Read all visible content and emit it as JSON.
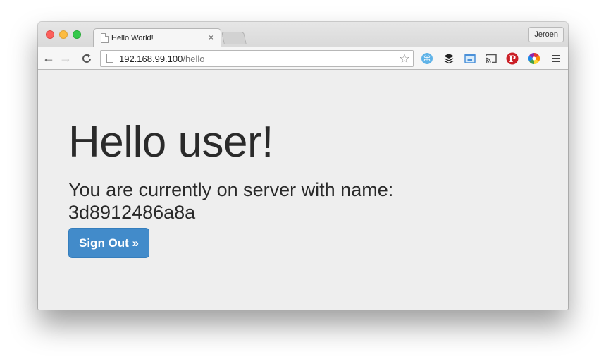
{
  "browser": {
    "tab_title": "Hello World!",
    "tab_close": "×",
    "profile_name": "Jeroen",
    "url_host": "192.168.99.100",
    "url_path": "/hello",
    "nav": {
      "back": "←",
      "forward": "→",
      "reload": "C"
    },
    "bookmark_star": "☆",
    "menu_glyph": "≡"
  },
  "page": {
    "heading": "Hello user!",
    "lead": "You are currently on server with name: 3d8912486a8a",
    "signout_label": "Sign Out »"
  },
  "colors": {
    "button_primary": "#428bca",
    "page_bg": "#eeeeee",
    "pinterest": "#cb2027"
  }
}
